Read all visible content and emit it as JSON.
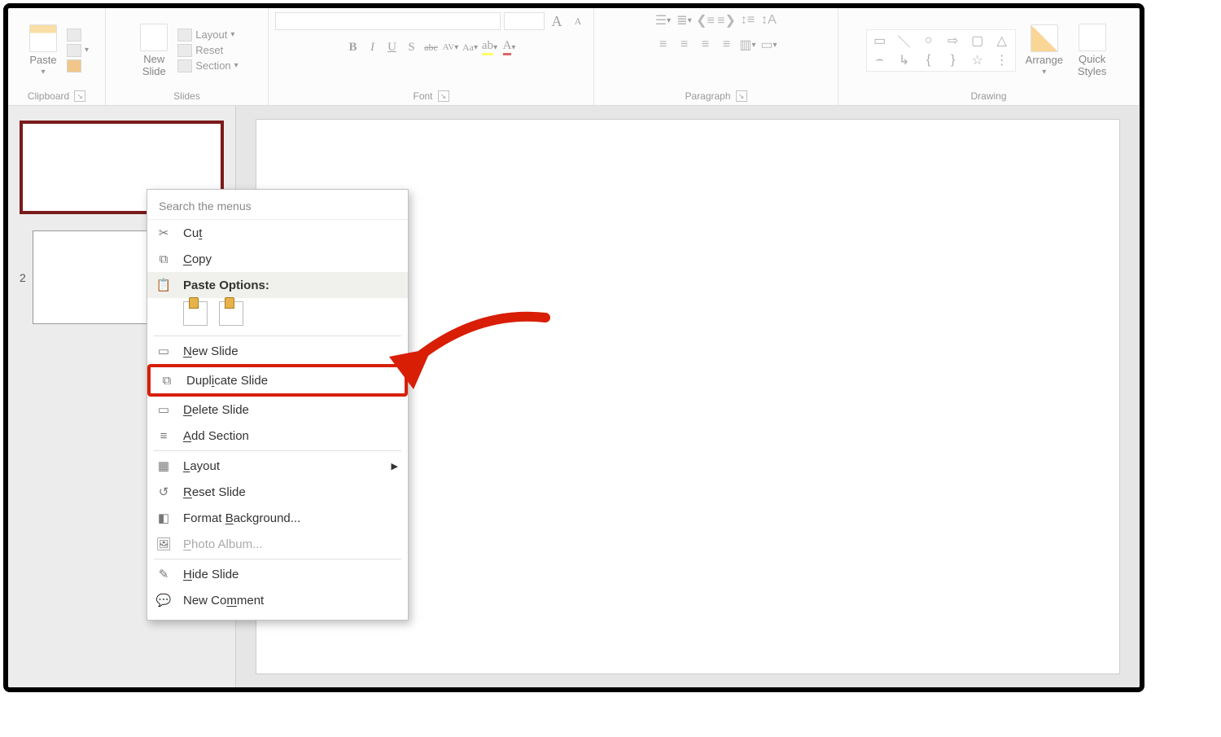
{
  "ribbon": {
    "clipboard": {
      "label": "Clipboard",
      "paste": "Paste"
    },
    "slides": {
      "label": "Slides",
      "new_slide": "New\nSlide",
      "layout": "Layout",
      "reset": "Reset",
      "section": "Section"
    },
    "font": {
      "label": "Font",
      "buttons": [
        "B",
        "I",
        "U",
        "S",
        "abc",
        "AV",
        "Aa",
        "A",
        "A"
      ],
      "size_up": "A",
      "size_down": "A"
    },
    "paragraph": {
      "label": "Paragraph"
    },
    "drawing": {
      "label": "Drawing",
      "arrange": "Arrange",
      "quick_styles": "Quick\nStyles"
    }
  },
  "thumbs": {
    "selected": 1,
    "slide2_num": "2"
  },
  "ctx": {
    "search_placeholder": "Search the menus",
    "cut": "Cut",
    "copy": "Copy",
    "paste_options": "Paste Options:",
    "new_slide": "New Slide",
    "duplicate_slide": "Duplicate Slide",
    "delete_slide": "Delete Slide",
    "add_section": "Add Section",
    "layout": "Layout",
    "reset_slide": "Reset Slide",
    "format_bg": "Format Background...",
    "photo_album": "Photo Album...",
    "hide_slide": "Hide Slide",
    "new_comment": "New Comment"
  }
}
